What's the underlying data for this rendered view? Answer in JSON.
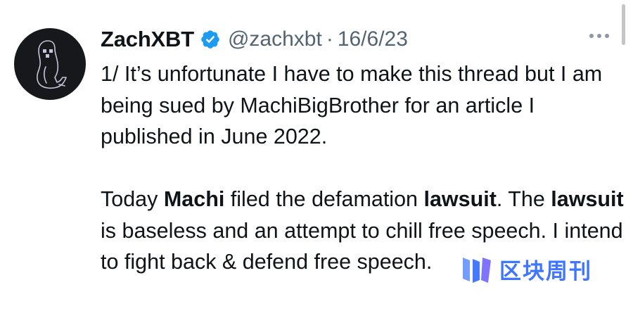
{
  "author": {
    "name": "ZachXBT",
    "handle": "@zachxbt",
    "separator": "·",
    "date": "16/6/23",
    "verified_color": "#1d9bf0",
    "avatar_icon": "ghost-penguin-outline"
  },
  "tweet": {
    "paragraph1": [
      "1/ It’s unfortunate I have to make this thread but I am being sued by MachiBigBrother for an article I published in June 2022."
    ],
    "paragraph2": {
      "t1": "Today ",
      "b1": "Machi",
      "t2": " filed the defamation ",
      "b2": "lawsuit",
      "t3": ". The ",
      "b3": "lawsuit",
      "t4": " is baseless and an attempt to chill free speech. I intend to fight back & defend free speech."
    }
  },
  "menu": {
    "icon": "more-horizontal-icon"
  },
  "watermark": {
    "text": "区块周刊",
    "color": "#2f6bff"
  }
}
